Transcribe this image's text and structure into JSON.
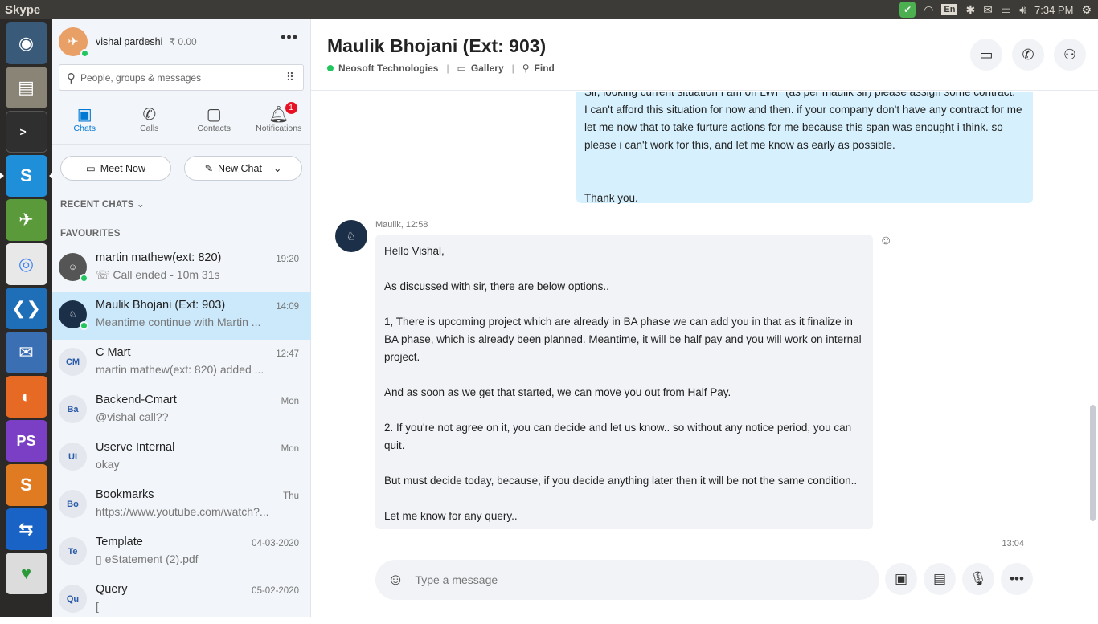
{
  "system": {
    "app_name": "Skype",
    "language": "En",
    "clock": "7:34 PM"
  },
  "profile": {
    "name": "vishal pardeshi",
    "credit": "₹ 0.00"
  },
  "search": {
    "placeholder": "People, groups & messages"
  },
  "tabs": [
    {
      "label": "Chats",
      "icon": "chat-icon"
    },
    {
      "label": "Calls",
      "icon": "phone-icon"
    },
    {
      "label": "Contacts",
      "icon": "contacts-icon"
    },
    {
      "label": "Notifications",
      "icon": "bell-icon",
      "badge": "1"
    }
  ],
  "actions": {
    "meet_now": "Meet Now",
    "new_chat": "New Chat"
  },
  "sections": {
    "recent": "RECENT CHATS",
    "favourites": "FAVOURITES"
  },
  "chats": [
    {
      "title": "martin mathew(ext: 820)",
      "subtitle": "Call ended - 10m 31s",
      "time": "19:20",
      "initials": ""
    },
    {
      "title": "Maulik Bhojani (Ext: 903)",
      "subtitle": "Meantime continue with Martin ...",
      "time": "14:09",
      "initials": ""
    },
    {
      "title": "C Mart",
      "subtitle": "martin mathew(ext: 820) added ...",
      "time": "12:47",
      "initials": "CM"
    },
    {
      "title": "Backend-Cmart",
      "subtitle": "@vishal call??",
      "time": "Mon",
      "initials": "Ba"
    },
    {
      "title": "Userve Internal",
      "subtitle": "okay",
      "time": "Mon",
      "initials": "UI"
    },
    {
      "title": "Bookmarks",
      "subtitle": "https://www.youtube.com/watch?...",
      "time": "Thu",
      "initials": "Bo"
    },
    {
      "title": "Template",
      "subtitle": "eStatement (2).pdf",
      "time": "04-03-2020",
      "initials": "Te"
    },
    {
      "title": "Query",
      "subtitle": "[",
      "time": "05-02-2020",
      "initials": "Qu"
    }
  ],
  "conversation": {
    "title": "Maulik Bhojani (Ext: 903)",
    "org": "Neosoft Technologies",
    "gallery": "Gallery",
    "find": "Find",
    "outgoing": [
      "Sir, looking current situation I am on LWP (as per maulik sir) please assign some contract.",
      "I can't afford this situation for now and then. if your company don't have any contract for me let me now that to take furture actions for me because this span was enought i think. so please i can't work for this, and let me know as early as possible.",
      "",
      "Thank you."
    ],
    "incoming_sender": "Maulik, 12:58",
    "incoming": [
      "Hello Vishal,",
      "",
      "As discussed with sir, there are below options..",
      "",
      "1, There is upcoming project which are already in BA phase we can add you in that as it finalize in BA phase, which is already been planned. Meantime, it will be half pay and you will work on internal project.",
      "",
      "And as soon as we get that started, we can move you out from Half Pay.",
      "",
      "2. If you're not agree on it, you can decide and let us know.. so without any notice period, you can quit.",
      "",
      "But must decide today, because, if you decide anything later then it will be not the same condition..",
      "",
      "Let me know for any query.."
    ],
    "last_time": "13:04"
  },
  "composer": {
    "placeholder": "Type a message"
  }
}
